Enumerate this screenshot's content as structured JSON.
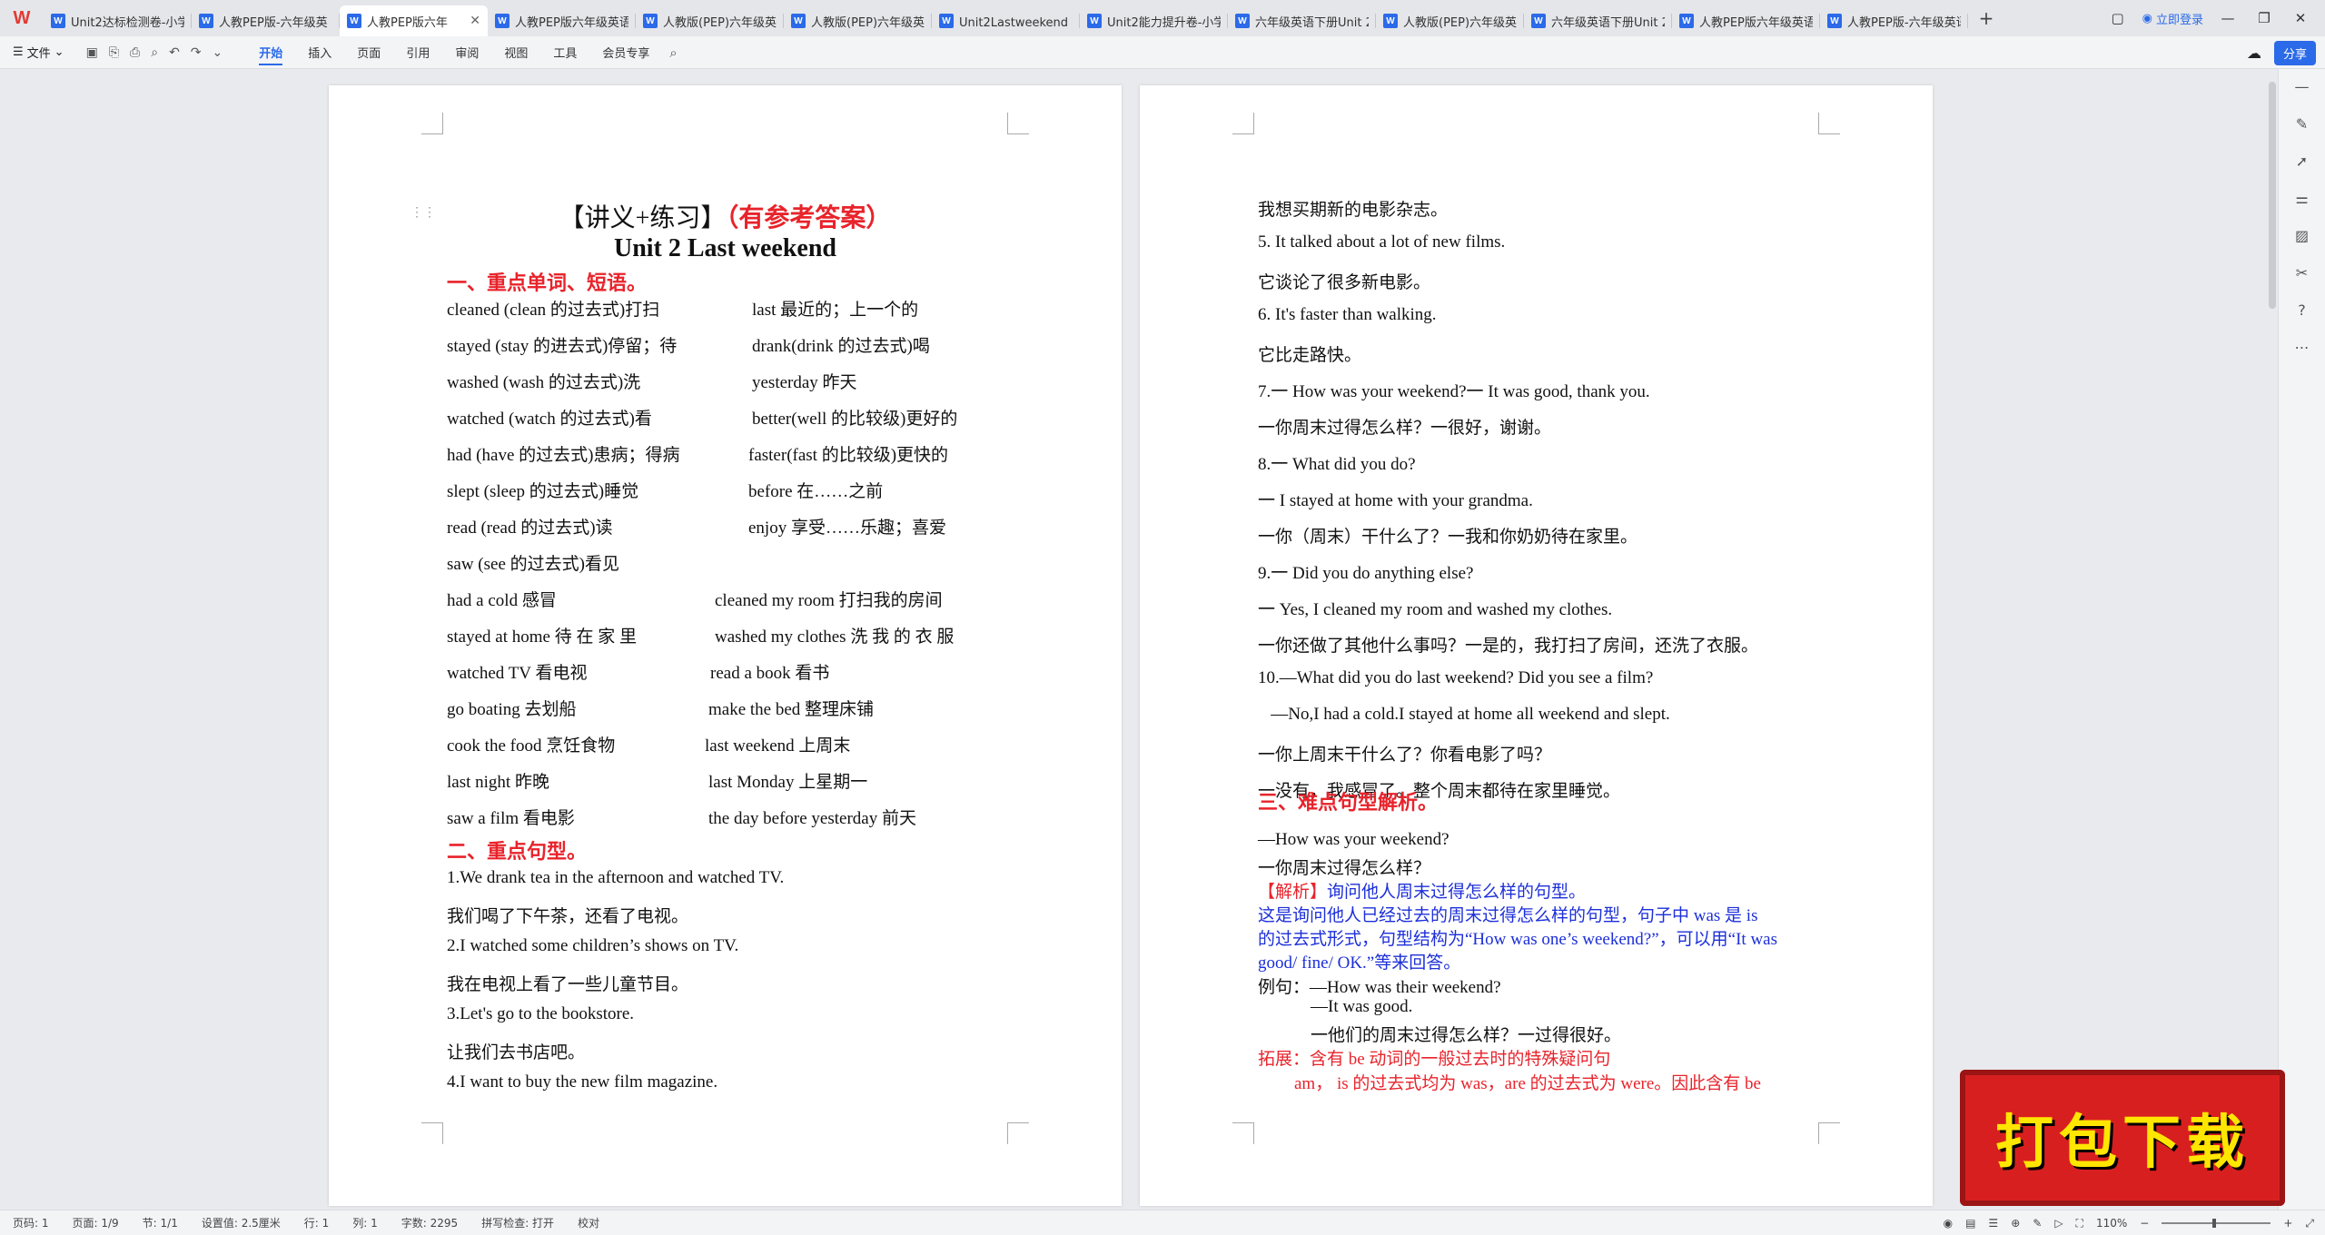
{
  "tabs": [
    {
      "label": "Unit2达标检测卷-小学"
    },
    {
      "label": "人教PEP版-六年级英"
    },
    {
      "label": "人教PEP版六年"
    },
    {
      "label": "人教PEP版六年级英语"
    },
    {
      "label": "人教版(PEP)六年级英"
    },
    {
      "label": "人教版(PEP)六年级英"
    },
    {
      "label": "Unit2Lastweekend（"
    },
    {
      "label": "Unit2能力提升卷-小学"
    },
    {
      "label": "六年级英语下册Unit 2"
    },
    {
      "label": "人教版(PEP)六年级英"
    },
    {
      "label": "六年级英语下册Unit 2"
    },
    {
      "label": "人教PEP版六年级英语"
    },
    {
      "label": "人教PEP版-六年级英语"
    }
  ],
  "active_tab": 2,
  "login_label": "立即登录",
  "ribbon": {
    "file_label": "文件",
    "tabs": [
      "开始",
      "插入",
      "页面",
      "引用",
      "审阅",
      "视图",
      "工具",
      "会员专享"
    ],
    "share_label": "分享"
  },
  "page1": {
    "title_a": "【讲义+练习】",
    "title_b": "（有参考答案）",
    "title_unit": "Unit 2 Last weekend",
    "sec1": "一、重点单词、短语。",
    "vocab": [
      [
        "cleaned (clean 的过去式)打扫",
        "last 最近的；上一个的"
      ],
      [
        "stayed (stay 的进去式)停留；待",
        "drank(drink 的过去式)喝"
      ],
      [
        "washed (wash 的过去式)洗",
        "yesterday 昨天"
      ],
      [
        "watched (watch 的过去式)看",
        "better(well 的比较级)更好的"
      ],
      [
        "had (have 的过去式)患病；得病",
        "faster(fast 的比较级)更快的"
      ],
      [
        "slept (sleep 的过去式)睡觉",
        "before 在……之前"
      ],
      [
        "read (read 的过去式)读",
        "enjoy 享受……乐趣；喜爱"
      ],
      [
        "saw (see 的过去式)看见",
        ""
      ],
      [
        "had a cold 感冒",
        "cleaned my room 打扫我的房间"
      ],
      [
        "stayed  at  home  待 在 家 里",
        "washed  my  clothes  洗 我 的 衣 服"
      ],
      [
        "watched TV 看电视",
        "read a book 看书"
      ],
      [
        "go boating 去划船",
        "make the bed 整理床铺"
      ],
      [
        "cook the food 烹饪食物",
        "last weekend 上周末"
      ],
      [
        "last night 昨晚",
        "last Monday 上星期一"
      ],
      [
        "saw a film 看电影",
        "the day before yesterday 前天"
      ]
    ],
    "sec2": "二、重点句型。",
    "sentences": [
      "1.We drank tea in the afternoon and watched TV.",
      "我们喝了下午茶，还看了电视。",
      "2.I watched some children’s shows on TV.",
      "我在电视上看了一些儿童节目。",
      "3.Let's go to the bookstore.",
      "让我们去书店吧。",
      "4.I want to buy the new film magazine."
    ]
  },
  "page2": {
    "lines": [
      "我想买期新的电影杂志。",
      "5. It talked about a lot of new films.",
      "它谈论了很多新电影。",
      "6. It's faster than walking.",
      "它比走路快。",
      "7.一 How was your weekend?一 It was good, thank you.",
      "一你周末过得怎么样？一很好，谢谢。",
      "8.一 What did you do?",
      "一 I stayed at home with your grandma.",
      "一你（周末）干什么了？一我和你奶奶待在家里。",
      "9.一 Did you do anything else?",
      "一 Yes, I cleaned my room and washed my clothes.",
      "一你还做了其他什么事吗？一是的，我打扫了房间，还洗了衣服。",
      "10.—What did you do last weekend? Did you see a film?",
      "   —No,I had a cold.I stayed at home all weekend and slept.",
      "一你上周末干什么了？你看电影了吗？",
      "一没有，我感冒了。整个周末都待在家里睡觉。"
    ],
    "sec3": "三、难点句型解析。",
    "analysis": {
      "q": "—How was your weekend?",
      "q_cn": "一你周末过得怎么样？",
      "tag": "【解析】",
      "tag_text": "询问他人周末过得怎么样的句型。",
      "explain1": "这是询问他人已经过去的周末过得怎么样的句型，句子中 was 是 is",
      "explain2": "的过去式形式，句型结构为“How was one’s weekend?”，可以用“It was",
      "explain3": "good/ fine/ OK.”等来回答。",
      "ex_label": "例句：",
      "ex1": "—How was their weekend?",
      "ex2": "—It was good.",
      "ex3": "一他们的周末过得怎么样？一过得很好。",
      "ext1": "拓展：含有 be 动词的一般过去时的特殊疑问句",
      "ext2": "am，  is  的过去式均为 was，are 的过去式为 were。因此含有 be"
    }
  },
  "status": {
    "page": "页码: 1",
    "pages": "页面: 1/9",
    "section": "节: 1/1",
    "setting": "设置值: 2.5厘米",
    "row": "行: 1",
    "col": "列: 1",
    "words": "字数: 2295",
    "spell": "拼写检查: 打开",
    "proof": "校对",
    "zoom": "110%"
  },
  "badge_text": "打包下载"
}
